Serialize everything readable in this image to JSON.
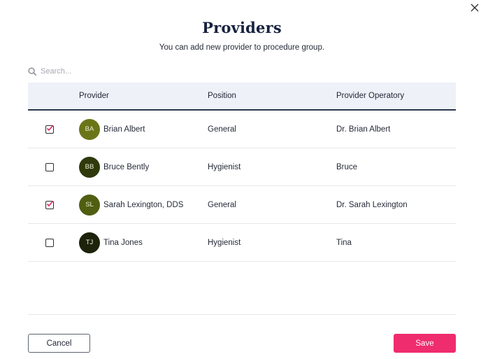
{
  "dialog": {
    "title": "Providers",
    "subtitle": "You can add new provider to procedure group."
  },
  "search": {
    "placeholder": "Search..."
  },
  "table": {
    "headers": {
      "provider": "Provider",
      "position": "Position",
      "operatory": "Provider Operatory"
    },
    "rows": [
      {
        "checked": true,
        "initials": "BA",
        "name": "Brian Albert",
        "position": "General",
        "operatory": "Dr. Brian Albert",
        "avatar_color": "#6b7518"
      },
      {
        "checked": false,
        "initials": "BB",
        "name": "Bruce Bently",
        "position": "Hygienist",
        "operatory": "Bruce",
        "avatar_color": "#2f3a0c"
      },
      {
        "checked": true,
        "initials": "SL",
        "name": "Sarah Lexington, DDS",
        "position": "General",
        "operatory": "Dr. Sarah Lexington",
        "avatar_color": "#505e12"
      },
      {
        "checked": false,
        "initials": "TJ",
        "name": "Tina Jones",
        "position": "Hygienist",
        "operatory": "Tina",
        "avatar_color": "#1d220a"
      }
    ]
  },
  "footer": {
    "cancel_label": "Cancel",
    "save_label": "Save"
  },
  "colors": {
    "accent": "#ef2c6e",
    "check": "#e0245e",
    "header_bg": "#eef1f7",
    "title": "#16223f"
  },
  "icons": {
    "close": "close-icon",
    "search": "search-icon",
    "check": "checkmark-icon"
  }
}
